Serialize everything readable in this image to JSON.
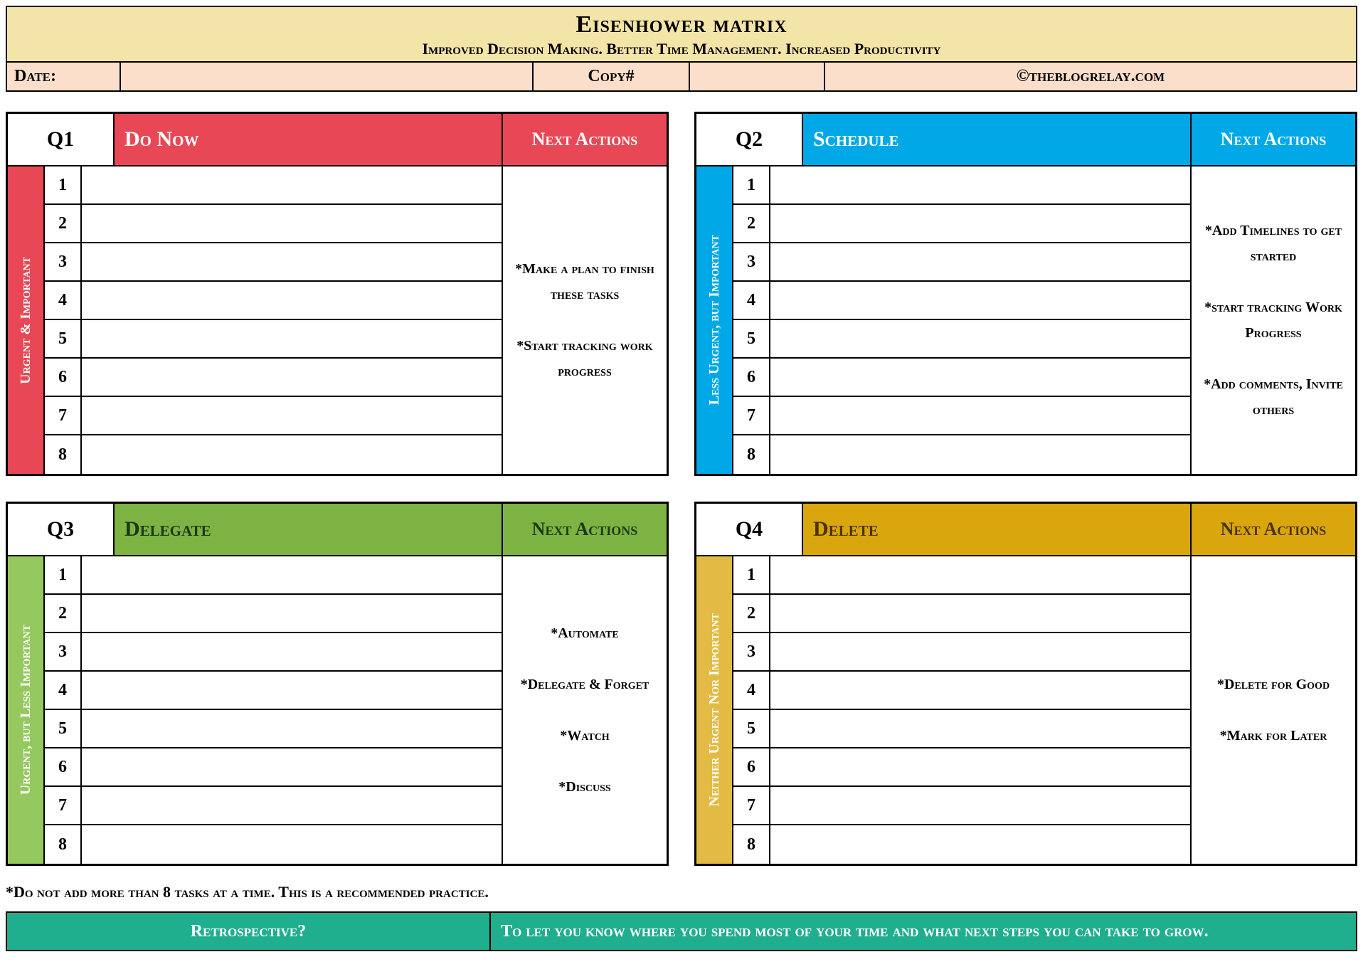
{
  "header": {
    "title": "Eisenhower matrix",
    "subtitle": "Improved Decision Making. Better Time Management. Increased Productivity"
  },
  "meta": {
    "date_label": "Date:",
    "date_value": "",
    "copy_label": "Copy#",
    "copy_value": "",
    "credit": "©theblogrelay.com"
  },
  "quadrants": [
    {
      "q": "Q1",
      "title": "Do Now",
      "next_label": "Next Actions",
      "side": "Urgent & Important",
      "actions": "*Make a plan to finish these tasks\n\n*Start tracking work progress",
      "rows": [
        "1",
        "2",
        "3",
        "4",
        "5",
        "6",
        "7",
        "8"
      ]
    },
    {
      "q": "Q2",
      "title": "Schedule",
      "next_label": "Next Actions",
      "side": "Less Urgent, but Important",
      "actions": "*Add Timelines to get started\n\n*start tracking Work Progress\n\n*Add comments, Invite others",
      "rows": [
        "1",
        "2",
        "3",
        "4",
        "5",
        "6",
        "7",
        "8"
      ]
    },
    {
      "q": "Q3",
      "title": "Delegate",
      "next_label": "Next Actions",
      "side": "Urgent, but Less Important",
      "actions": "*Automate\n\n*Delegate & Forget\n\n*Watch\n\n*Discuss",
      "rows": [
        "1",
        "2",
        "3",
        "4",
        "5",
        "6",
        "7",
        "8"
      ]
    },
    {
      "q": "Q4",
      "title": "Delete",
      "next_label": "Next Actions",
      "side": "Neither Urgent Nor Important",
      "actions": "*Delete for Good\n\n*Mark for Later",
      "rows": [
        "1",
        "2",
        "3",
        "4",
        "5",
        "6",
        "7",
        "8"
      ]
    }
  ],
  "footnote": "*Do not add more than 8 tasks at a time. This is a recommended practice.",
  "retrospective": {
    "label": "Retrospective?",
    "text": "To let you know where you spend most of your time and what next steps you can take to grow."
  }
}
